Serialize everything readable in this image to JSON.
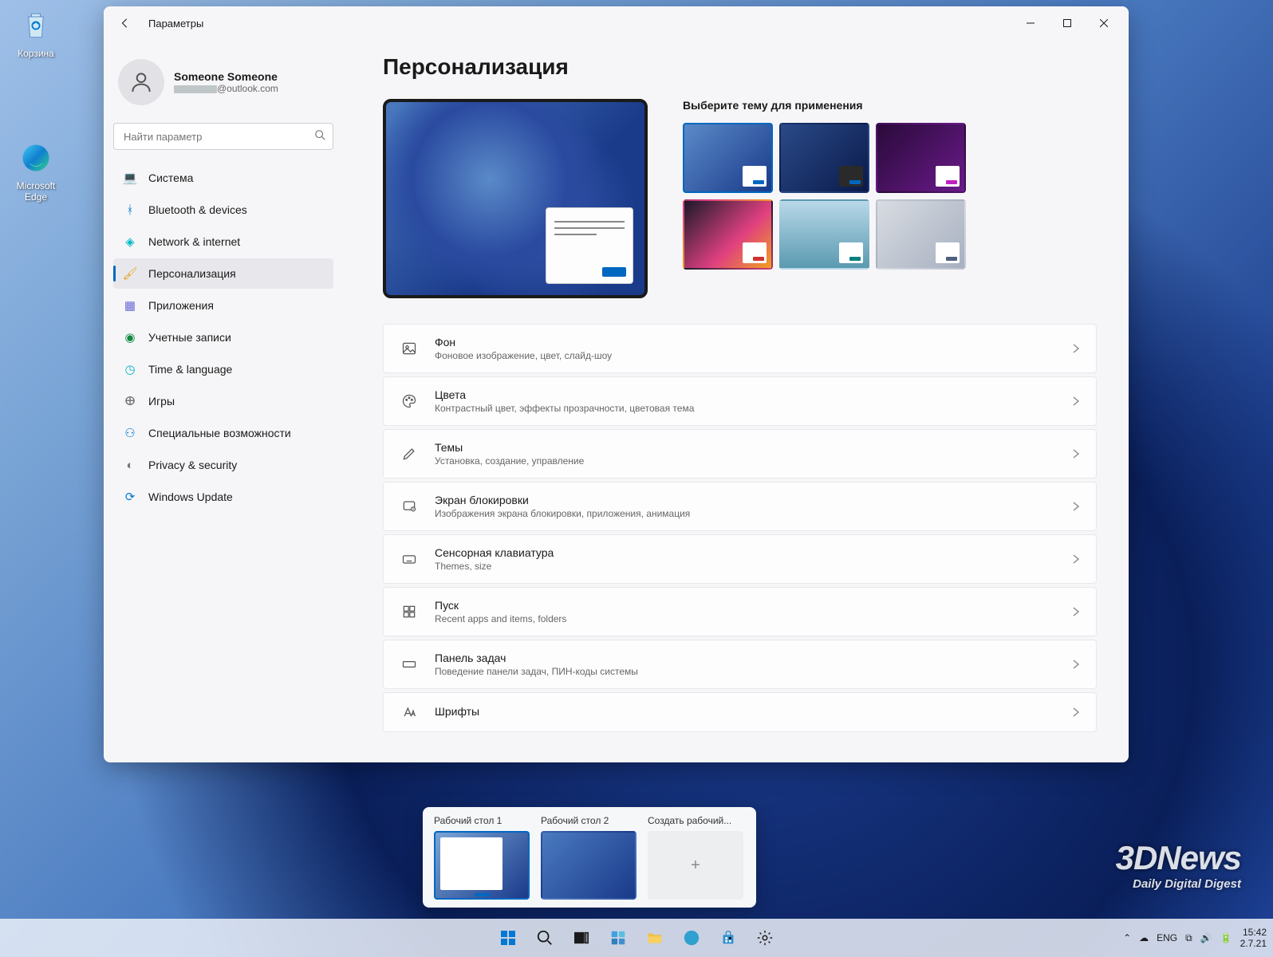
{
  "desktop_icons": [
    {
      "name": "recycle-bin",
      "label": "Корзина"
    },
    {
      "name": "edge-browser",
      "label": "Microsoft Edge"
    }
  ],
  "window": {
    "title": "Параметры",
    "user": {
      "name": "Someone Someone",
      "email": "@outlook.com"
    },
    "search_placeholder": "Найти параметр"
  },
  "nav": [
    {
      "name": "system",
      "label": "Система",
      "icon": "💻",
      "color": "#0078d4"
    },
    {
      "name": "bluetooth",
      "label": "Bluetooth & devices",
      "icon": "ᚼ",
      "color": "#0078d4"
    },
    {
      "name": "network",
      "label": "Network & internet",
      "icon": "◈",
      "color": "#00b7c3"
    },
    {
      "name": "personalization",
      "label": "Персонализация",
      "icon": "🖌",
      "color": "#e3a21a",
      "active": true
    },
    {
      "name": "apps",
      "label": "Приложения",
      "icon": "▦",
      "color": "#6b69d6"
    },
    {
      "name": "accounts",
      "label": "Учетные записи",
      "icon": "◉",
      "color": "#10893e"
    },
    {
      "name": "time-language",
      "label": "Time & language",
      "icon": "◷",
      "color": "#00b7c3"
    },
    {
      "name": "gaming",
      "label": "Игры",
      "icon": "ⴲ",
      "color": "#767676"
    },
    {
      "name": "accessibility",
      "label": "Специальные возможности",
      "icon": "⚇",
      "color": "#0078d4"
    },
    {
      "name": "privacy",
      "label": "Privacy & security",
      "icon": "◐",
      "color": "#767676"
    },
    {
      "name": "update",
      "label": "Windows Update",
      "icon": "⟳",
      "color": "#0078d4"
    }
  ],
  "page": {
    "title": "Персонализация",
    "themes_label": "Выберите тему для применения",
    "themes": [
      {
        "bg": "linear-gradient(135deg,#5a8ac8,#1a3a8a)",
        "accent": "#0067c0",
        "mini": "light",
        "selected": true
      },
      {
        "bg": "linear-gradient(135deg,#2a4a88,#0a1a4a)",
        "accent": "#0067c0",
        "mini": "dark"
      },
      {
        "bg": "linear-gradient(135deg,#2a0a3a,#6a1a8a)",
        "accent": "#c020c0",
        "mini": "light"
      },
      {
        "bg": "linear-gradient(135deg,#1a1a2a,#e04080 60%,#f0a020)",
        "accent": "#d03030",
        "mini": "light"
      },
      {
        "bg": "linear-gradient(180deg,#b8d8e8,#5a9ab0)",
        "accent": "#008080",
        "mini": "light"
      },
      {
        "bg": "linear-gradient(135deg,#d8dce2,#a8b0c0)",
        "accent": "#506080",
        "mini": "light"
      }
    ],
    "rows": [
      {
        "name": "background",
        "title": "Фон",
        "sub": "Фоновое изображение, цвет, слайд-шоу",
        "icon": "image"
      },
      {
        "name": "colors",
        "title": "Цвета",
        "sub": "Контрастный цвет, эффекты прозрачности, цветовая тема",
        "icon": "palette"
      },
      {
        "name": "themes",
        "title": "Темы",
        "sub": "Установка, создание, управление",
        "icon": "pen"
      },
      {
        "name": "lockscreen",
        "title": "Экран блокировки",
        "sub": "Изображения экрана блокировки, приложения, анимация",
        "icon": "lock"
      },
      {
        "name": "touch-keyboard",
        "title": "Сенсорная клавиатура",
        "sub": "Themes, size",
        "icon": "keyboard"
      },
      {
        "name": "start",
        "title": "Пуск",
        "sub": "Recent apps and items, folders",
        "icon": "start"
      },
      {
        "name": "taskbar",
        "title": "Панель задач",
        "sub": "Поведение панели задач, ПИН-коды системы",
        "icon": "taskbar"
      },
      {
        "name": "fonts",
        "title": "Шрифты",
        "sub": "",
        "icon": "fonts"
      }
    ]
  },
  "taskview": {
    "items": [
      {
        "name": "desktop-1",
        "label": "Рабочий стол 1",
        "active": true,
        "type": "settings"
      },
      {
        "name": "desktop-2",
        "label": "Рабочий стол 2",
        "type": "wallpaper"
      },
      {
        "name": "new-desktop",
        "label": "Создать рабочий...",
        "type": "new"
      }
    ]
  },
  "taskbar_icons": [
    "start",
    "search",
    "taskview",
    "widgets",
    "explorer",
    "edge",
    "store",
    "settings"
  ],
  "tray": {
    "lang": "ENG",
    "time": "15:42",
    "date": "2.7.21"
  },
  "watermark": {
    "line1": "3DNews",
    "line2": "Daily Digital Digest"
  }
}
